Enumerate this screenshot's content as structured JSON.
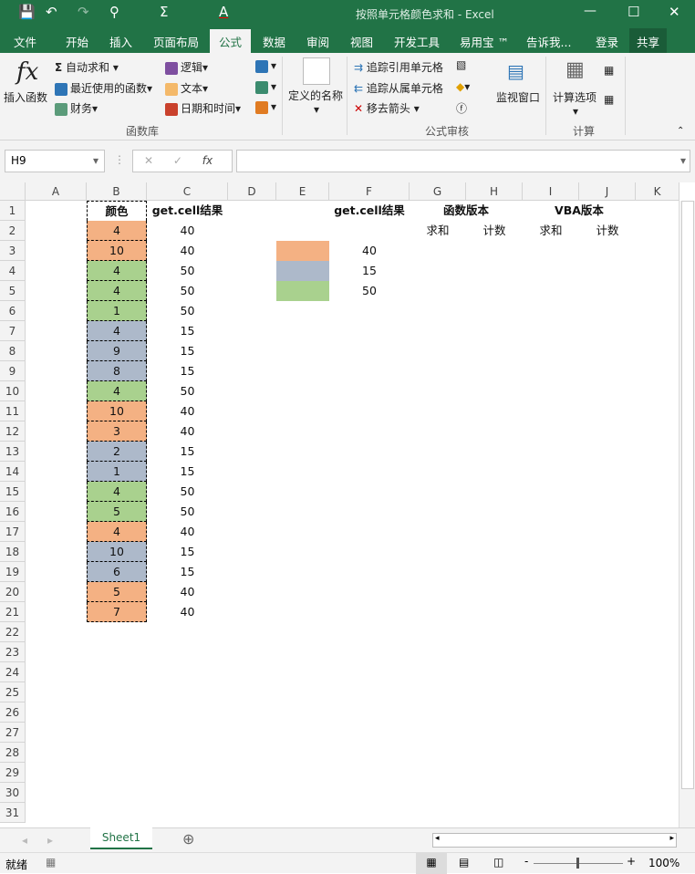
{
  "window": {
    "title": "按照单元格颜色求和 - Excel"
  },
  "tabs": [
    "文件",
    "开始",
    "插入",
    "页面布局",
    "公式",
    "数据",
    "审阅",
    "视图",
    "开发工具",
    "易用宝 ™"
  ],
  "active_tab": "公式",
  "tell_me": "告诉我...",
  "login": "登录",
  "share": "共享",
  "ribbon": {
    "insert_function": "插入函数",
    "autosum": "自动求和",
    "recent": "最近使用的函数",
    "financial": "财务",
    "logical": "逻辑",
    "text": "文本",
    "datetime": "日期和时间",
    "function_library": "函数库",
    "defined_names": "定义的名称",
    "trace_precedents": "追踪引用单元格",
    "trace_dependents": "追踪从属单元格",
    "remove_arrows": "移去箭头",
    "formula_auditing": "公式审核",
    "watch_window": "监视窗口",
    "calc_options": "计算选项",
    "calculation": "计算"
  },
  "formula_bar": {
    "name_box": "H9",
    "formula": ""
  },
  "columns": [
    "A",
    "B",
    "C",
    "D",
    "E",
    "F",
    "G",
    "H",
    "I",
    "J",
    "K"
  ],
  "colors": {
    "orange": "#F4B183",
    "blue": "#ADB9CA",
    "green": "#A9D18E"
  },
  "headers": {
    "B1": "颜色",
    "C1": "get.cell结果",
    "F1": "get.cell结果",
    "G1": "函数版本",
    "I1": "VBA版本",
    "G2": "求和",
    "H2": "计数",
    "I2": "求和",
    "J2": "计数"
  },
  "rows": [
    {
      "b": "4",
      "color": "orange",
      "c": "40"
    },
    {
      "b": "10",
      "color": "orange",
      "c": "40"
    },
    {
      "b": "4",
      "color": "green",
      "c": "50"
    },
    {
      "b": "4",
      "color": "green",
      "c": "50"
    },
    {
      "b": "1",
      "color": "green",
      "c": "50"
    },
    {
      "b": "4",
      "color": "blue",
      "c": "15"
    },
    {
      "b": "9",
      "color": "blue",
      "c": "15"
    },
    {
      "b": "8",
      "color": "blue",
      "c": "15"
    },
    {
      "b": "4",
      "color": "green",
      "c": "50"
    },
    {
      "b": "10",
      "color": "orange",
      "c": "40"
    },
    {
      "b": "3",
      "color": "orange",
      "c": "40"
    },
    {
      "b": "2",
      "color": "blue",
      "c": "15"
    },
    {
      "b": "1",
      "color": "blue",
      "c": "15"
    },
    {
      "b": "4",
      "color": "green",
      "c": "50"
    },
    {
      "b": "5",
      "color": "green",
      "c": "50"
    },
    {
      "b": "4",
      "color": "orange",
      "c": "40"
    },
    {
      "b": "10",
      "color": "blue",
      "c": "15"
    },
    {
      "b": "6",
      "color": "blue",
      "c": "15"
    },
    {
      "b": "5",
      "color": "orange",
      "c": "40"
    },
    {
      "b": "7",
      "color": "orange",
      "c": "40"
    }
  ],
  "legend": [
    {
      "color": "orange",
      "value": "40"
    },
    {
      "color": "blue",
      "value": "15"
    },
    {
      "color": "green",
      "value": "50"
    }
  ],
  "sheet_tab": "Sheet1",
  "status": {
    "ready": "就绪",
    "zoom": "100%"
  }
}
